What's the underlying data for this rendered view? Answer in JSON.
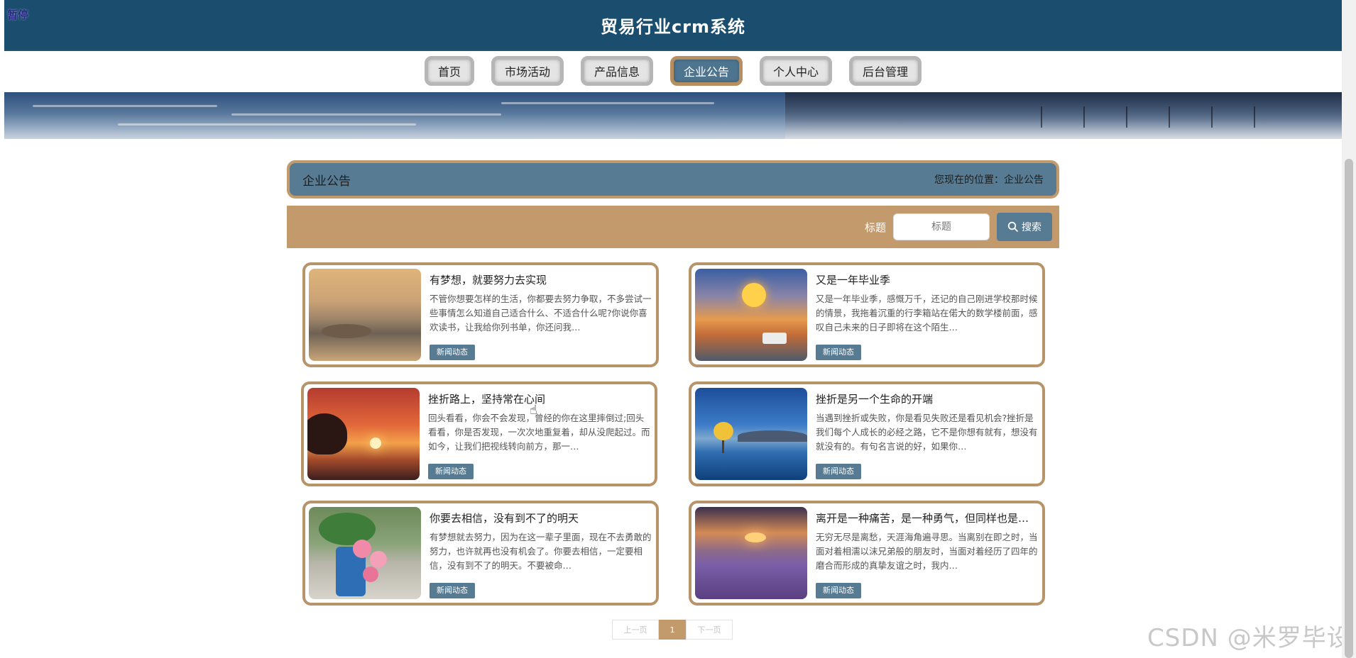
{
  "overlay": {
    "pause_label": "暂停"
  },
  "header": {
    "title": "贸易行业crm系统"
  },
  "nav": {
    "items": [
      {
        "label": "首页",
        "active": false
      },
      {
        "label": "市场活动",
        "active": false
      },
      {
        "label": "产品信息",
        "active": false
      },
      {
        "label": "企业公告",
        "active": true
      },
      {
        "label": "个人中心",
        "active": false
      },
      {
        "label": "后台管理",
        "active": false
      }
    ]
  },
  "section": {
    "title": "企业公告",
    "location_text": "您现在的位置：企业公告"
  },
  "search": {
    "label": "标题",
    "placeholder": "标题",
    "button_label": "搜索"
  },
  "cards": [
    {
      "title": "有梦想，就要努力去实现",
      "desc": "不管你想要怎样的生活，你都要去努力争取，不多尝试一些事情怎么知道自己适合什么、不适合什么呢?你说你喜欢读书，让我给你列书单，你还问我…",
      "tag": "新闻动态"
    },
    {
      "title": "又是一年毕业季",
      "desc": "又是一年毕业季，感慨万千，还记的自己刚进学校那时候的情景，我拖着沉重的行李箱站在偌大的数学楼前面，感叹自己未来的日子即将在这个陌生…",
      "tag": "新闻动态"
    },
    {
      "title": "挫折路上，坚持常在心间",
      "desc": "回头看看，你会不会发现，曾经的你在这里摔倒过;回头看看，你是否发现，一次次地重复着，却从没爬起过。而如今，让我们把视线转向前方，那一…",
      "tag": "新闻动态"
    },
    {
      "title": "挫折是另一个生命的开端",
      "desc": "当遇到挫折或失败，你是看见失败还是看见机会?挫折是我们每个人成长的必经之路，它不是你想有就有，想没有就没有的。有句名言说的好，如果你…",
      "tag": "新闻动态"
    },
    {
      "title": "你要去相信，没有到不了的明天",
      "desc": "有梦想就去努力，因为在这一辈子里面，现在不去勇敢的努力，也许就再也没有机会了。你要去相信，一定要相信，没有到不了的明天。不要被命…",
      "tag": "新闻动态"
    },
    {
      "title": "离开是一种痛苦，是一种勇气，但同样也是一个考验",
      "desc": "无穷无尽是离愁，天涯海角遍寻思。当离别在即之时，当面对着相濡以沫兄弟般的朋友时，当面对着经历了四年的磨合而形成的真挚友谊之时，我内…",
      "tag": "新闻动态"
    }
  ],
  "pagination": {
    "prev": "上一页",
    "current": "1",
    "next": "下一页"
  },
  "watermark": "CSDN @米罗毕设"
}
